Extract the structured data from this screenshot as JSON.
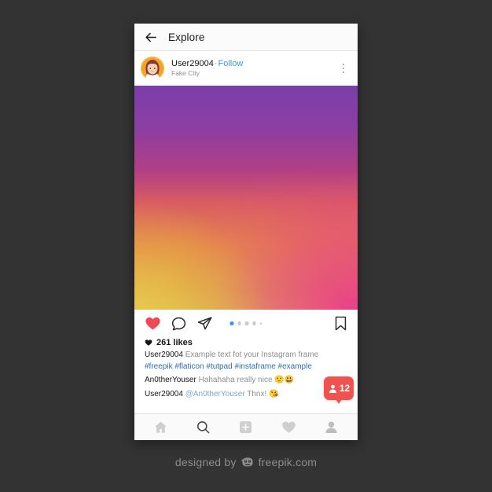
{
  "background_color": "#333334",
  "phone": {
    "explore_bar": {
      "back_icon": "back-arrow-icon",
      "title": "Explore"
    },
    "user_row": {
      "avatar_icon": "user-avatar",
      "username": "User29004",
      "separator": "·",
      "follow_label": "Follow",
      "location": "Fake City",
      "more_icon": "more-vertical-icon"
    },
    "photo": {
      "name": "gradient-photo",
      "colors": {
        "top_left": "#7b3ea9",
        "top_right": "#6b42a8",
        "bottom_left": "#dfae46",
        "bottom_right": "#e8458c",
        "mid": "#d95c62"
      }
    },
    "actions": {
      "like_icon": "heart-filled-icon",
      "like_color": "#ed4956",
      "comment_icon": "comment-bubble-icon",
      "share_icon": "paper-plane-icon",
      "bookmark_icon": "bookmark-icon",
      "pagination": {
        "total": 5,
        "active_index": 0,
        "active_color": "#3897f0",
        "inactive_color": "#c4cad0"
      }
    },
    "content": {
      "likes_heart_icon": "heart-small-icon",
      "likes_text": "261 likes",
      "caption": {
        "user": "User29004",
        "text": "Example text fot your Instagram frame",
        "hashtags": "#freepik #flaticon #tutpad #instaframe #example"
      },
      "comments": [
        {
          "user": "An0therYouser",
          "text": "Hahahaha really nice",
          "emoji": "🙂😃"
        },
        {
          "user": "User29004",
          "mention": "@An0therYouser",
          "text": "Thnx!",
          "emoji": "😘"
        }
      ],
      "notification": {
        "icon": "person-icon",
        "count": "12",
        "color": "#ef5350"
      }
    },
    "bottom_nav": [
      {
        "icon": "home-icon",
        "active": false
      },
      {
        "icon": "search-icon",
        "active": true
      },
      {
        "icon": "add-box-icon",
        "active": false
      },
      {
        "icon": "heart-icon",
        "active": false
      },
      {
        "icon": "profile-icon",
        "active": false
      }
    ]
  },
  "footer": {
    "prefix": "designed by",
    "logo_icon": "freepik-logo-icon",
    "brand": "freepik.com"
  }
}
